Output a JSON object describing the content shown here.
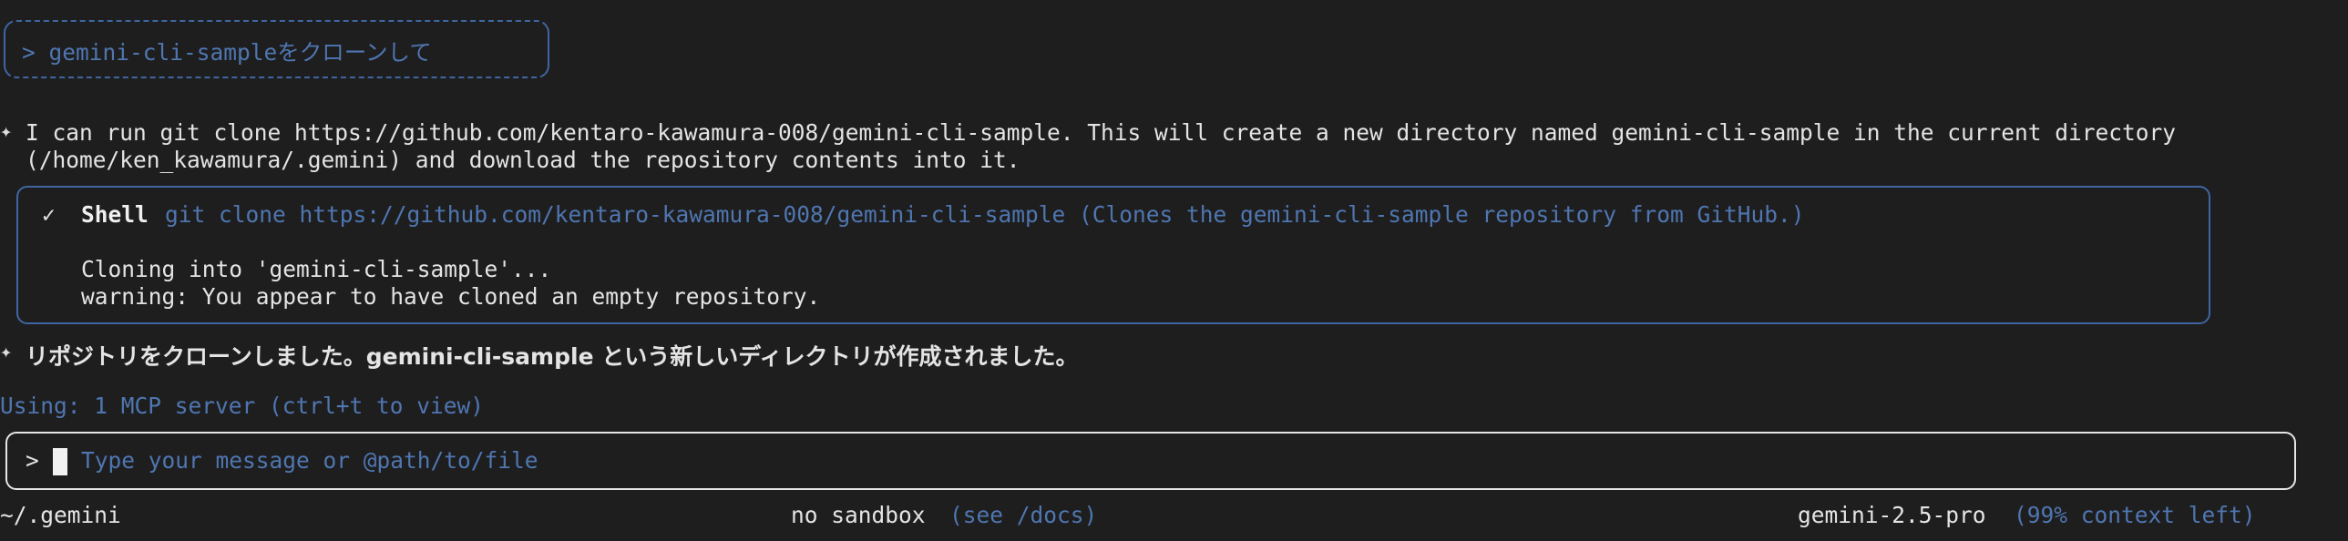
{
  "prompt_history": {
    "text": "> gemini-cli-sampleをクローンして"
  },
  "assistant_message_1": {
    "bullet": "✦",
    "line1": "I can run git clone https://github.com/kentaro-kawamura-008/gemini-cli-sample. This will create a new directory named gemini-cli-sample in the current directory",
    "line2": "(/home/ken_kawamura/.gemini) and download the repository contents into it."
  },
  "tool_call": {
    "status_icon": "✓",
    "tool_name": "Shell",
    "command": "git clone https://github.com/kentaro-kawamura-008/gemini-cli-sample (Clones the gemini-cli-sample repository from GitHub.)",
    "output_line1": "Cloning into 'gemini-cli-sample'...",
    "output_line2": "warning: You appear to have cloned an empty repository."
  },
  "assistant_message_2": {
    "bullet": "✦",
    "text": "リポジトリをクローンしました。gemini-cli-sample という新しいディレクトリが作成されました。"
  },
  "mcp_status": {
    "text": "Using: 1 MCP server (ctrl+t to view)"
  },
  "input": {
    "prompt_symbol": ">",
    "placeholder": "Type your message or @path/to/file"
  },
  "footer": {
    "cwd": "~/.gemini",
    "sandbox": "no sandbox",
    "sandbox_hint": "(see /docs)",
    "model": "gemini-2.5-pro",
    "context": "(99% context left)"
  },
  "colors": {
    "background": "#1e1e1f",
    "accent_blue": "#4f76b0",
    "frame_blue": "#3f66a3",
    "text": "#e4e4e4"
  }
}
